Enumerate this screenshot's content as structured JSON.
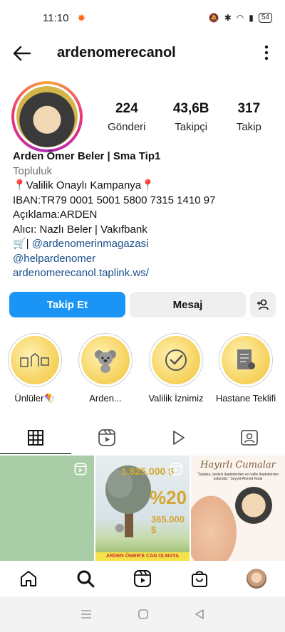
{
  "status_bar": {
    "time": "11:10",
    "battery": "54"
  },
  "header": {
    "username": "ardenomerecanol"
  },
  "profile": {
    "stats": [
      {
        "value": "224",
        "label": "Gönderi"
      },
      {
        "value": "43,6B",
        "label": "Takipçi"
      },
      {
        "value": "317",
        "label": "Takip"
      }
    ],
    "name": "Arden Ömer Beler | Sma Tip1",
    "category": "Topluluk",
    "bio_lines": [
      "📍Valilik Onaylı Kampanya📍",
      "IBAN:TR79 0001 5001 5800 7315 1410 97",
      "Açıklama:ARDEN",
      "Alıcı: Nazlı Beler | Vakıfbank"
    ],
    "bio_cart_prefix": "🛒| ",
    "bio_cart_link": "@ardenomerinmagazasi",
    "bio_mention": "@helpardenomer",
    "website": "ardenomerecanol.taplink.ws/"
  },
  "actions": {
    "follow": "Takip Et",
    "message": "Mesaj"
  },
  "highlights": [
    {
      "label": "Ünlüler🪁"
    },
    {
      "label": "Arden..."
    },
    {
      "label": "Valilik İznimiz"
    },
    {
      "label": "Hastane Teklifi"
    }
  ],
  "grid": {
    "post2": {
      "amount": "1.825.000 $",
      "percent": "%20",
      "goal": "365.000 $",
      "banner": "ARDEN ÖMER'E CAN OLMAYA"
    },
    "post3": {
      "title": "Hayırlı Cumalar",
      "subtitle": "\"Sadaka, bedeni ibadetlerden ve nafile ibadetlerden üstündür.\" Seyyid Ahmed Rufai"
    }
  }
}
